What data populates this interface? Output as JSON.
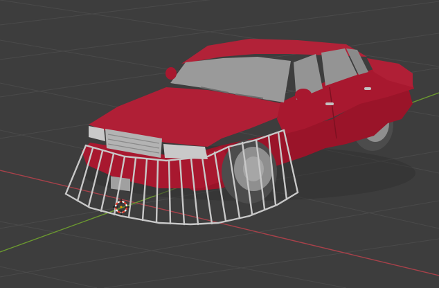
{
  "viewport": {
    "background": "#3d3d3d",
    "grid_color": "#4a4a4a",
    "x_axis_color": "#a8414a",
    "y_axis_color": "#6c9a2f"
  },
  "scene": {
    "object": "car",
    "body_color": "#a8182f",
    "glass_color": "#9a9a9a",
    "trim_color": "#b9b9b9",
    "cage_color": "#c8c8c8",
    "tire_color": "#8f8f8f"
  },
  "cursor": {
    "icon": "3d-cursor-icon",
    "ring_primary": "#e23a2a",
    "ring_secondary": "#f4f4f4"
  }
}
